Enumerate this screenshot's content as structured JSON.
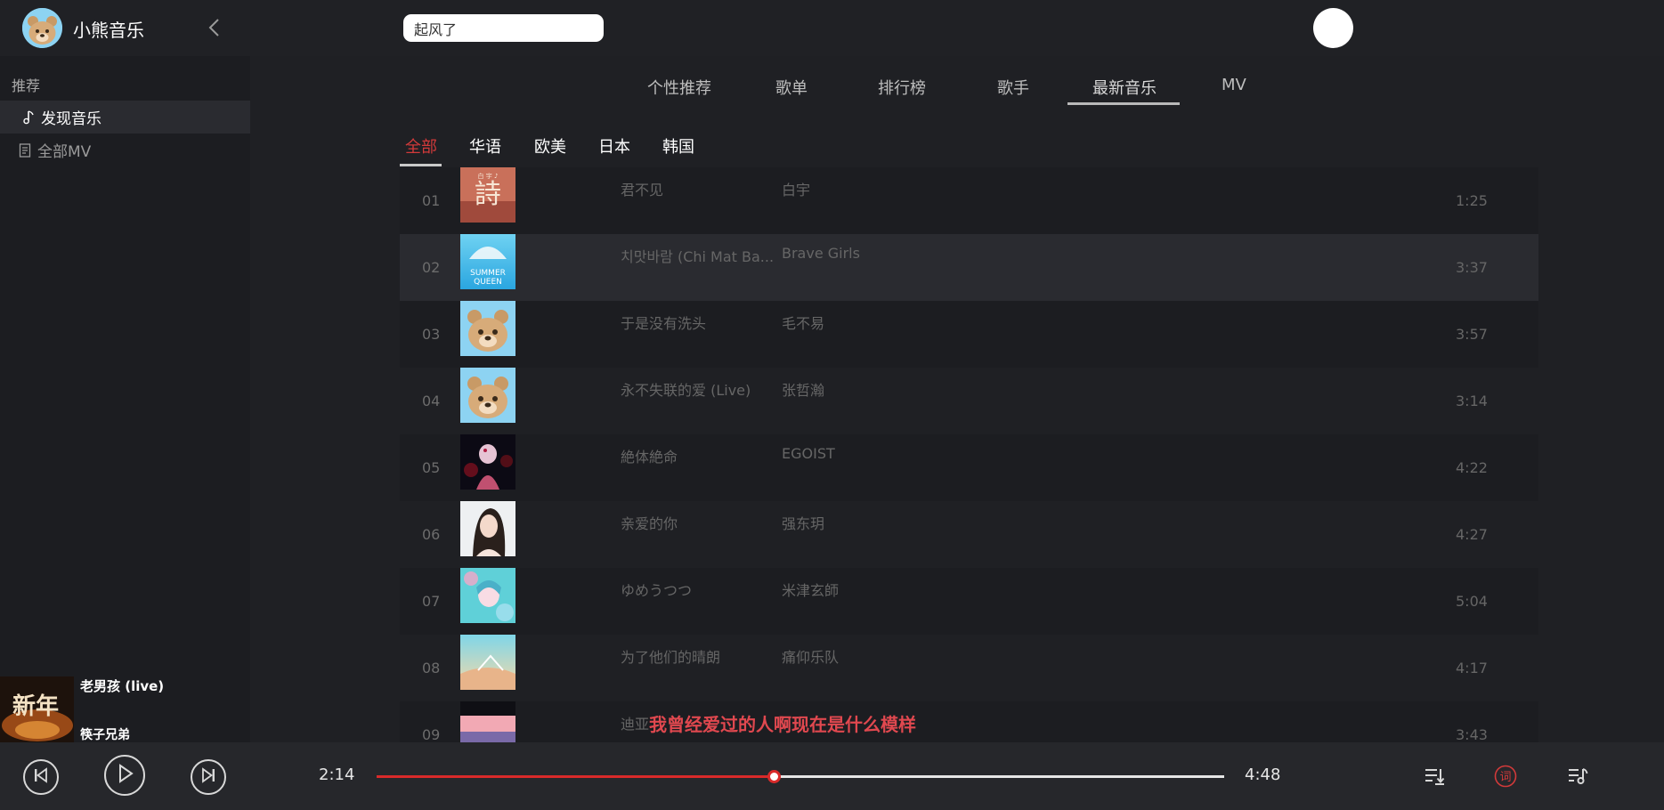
{
  "header": {
    "app_title": "小熊音乐",
    "search_value": "起风了"
  },
  "sidebar": {
    "section_label": "推荐",
    "items": [
      {
        "label": "发现音乐",
        "icon": "music-note-icon",
        "active": true
      },
      {
        "label": "全部MV",
        "icon": "document-icon",
        "active": false
      }
    ]
  },
  "main_tabs": [
    "个性推荐",
    "歌单",
    "排行榜",
    "歌手",
    "最新音乐",
    "MV"
  ],
  "active_main_tab": "最新音乐",
  "sub_tabs": [
    "全部",
    "华语",
    "欧美",
    "日本",
    "韩国"
  ],
  "active_sub_tab": "全部",
  "songs": [
    {
      "num": "01",
      "name": "君不见",
      "artist": "白宇",
      "duration": "1:25"
    },
    {
      "num": "02",
      "name": "치맛바람 (Chi Mat Ba...",
      "artist": "Brave Girls",
      "duration": "3:37"
    },
    {
      "num": "03",
      "name": "于是没有洗头",
      "artist": "毛不易",
      "duration": "3:57"
    },
    {
      "num": "04",
      "name": "永不失联的爱 (Live)",
      "artist": "张哲瀚",
      "duration": "3:14"
    },
    {
      "num": "05",
      "name": "絶体絶命",
      "artist": "EGOIST",
      "duration": "4:22"
    },
    {
      "num": "06",
      "name": "亲爱的你",
      "artist": "强东玥",
      "duration": "4:27"
    },
    {
      "num": "07",
      "name": "ゆめうつつ",
      "artist": "米津玄師",
      "duration": "5:04"
    },
    {
      "num": "08",
      "name": "为了他们的晴朗",
      "artist": "痛仰乐队",
      "duration": "4:17"
    },
    {
      "num": "09",
      "name": "迪亚",
      "artist": "",
      "duration": "3:43"
    }
  ],
  "covers": {
    "row1_text": "詩",
    "row1_small": "白 宇 ♪",
    "row2_text_1": "SUMMER",
    "row2_text_2": "QUEEN"
  },
  "now_playing": {
    "title": "老男孩 (live)",
    "artist": "筷子兄弟",
    "cover_text": "新年"
  },
  "lyric": "我曾经爱过的人啊现在是什么模样",
  "player": {
    "current_time": "2:14",
    "total_time": "4:48",
    "progress": 0.469,
    "lyric_button_glyph": "词"
  },
  "colors": {
    "accent_red": "#d23a3a",
    "background": "#1f2024",
    "sidebar_bg": "#1c1d21",
    "player_bg": "#26272b"
  }
}
